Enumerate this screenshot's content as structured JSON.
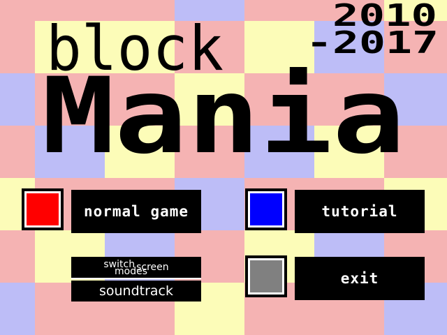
{
  "years": {
    "start": "2010",
    "end": "-2017"
  },
  "title": {
    "line1": "block",
    "line2": "Mania"
  },
  "menu": {
    "normal_game": {
      "label": "normal game",
      "color": "#ff0000"
    },
    "tutorial": {
      "label": "tutorial",
      "color": "#0000ff"
    },
    "exit": {
      "label": "exit",
      "color": "#808080"
    },
    "switch_screen_modes": {
      "part1": "switch",
      "part2": "screen",
      "part3": "modes"
    },
    "soundtrack": {
      "label": "soundtrack"
    }
  },
  "colors": {
    "pink": "#f5b3b3",
    "yellow": "#fcfcb8",
    "lavender": "#bdbdf7"
  }
}
